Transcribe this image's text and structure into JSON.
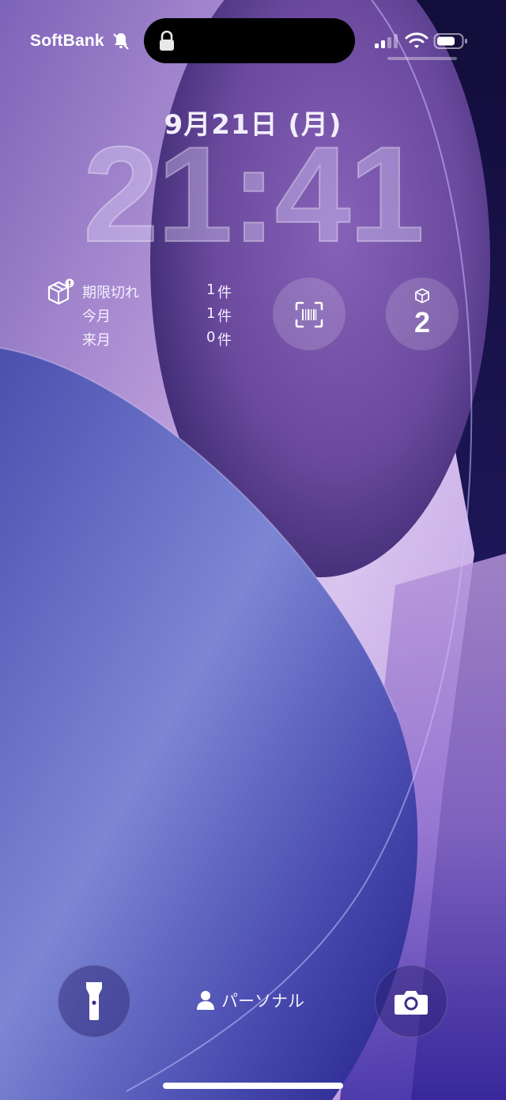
{
  "status_bar": {
    "carrier": "SoftBank",
    "icons": [
      "bell-slash-icon",
      "lock-icon",
      "cellular-signal-icon",
      "wifi-icon",
      "battery-icon"
    ]
  },
  "lock_screen": {
    "date": "9月21日 (月)",
    "time": "21:41"
  },
  "widgets": {
    "expiry_list": {
      "icon": "package-icon",
      "rows": [
        {
          "label": "期限切れ",
          "count": "1",
          "unit": "件"
        },
        {
          "label": "今月",
          "count": "1",
          "unit": "件"
        },
        {
          "label": "来月",
          "count": "0",
          "unit": "件"
        }
      ]
    },
    "barcode_scan": {
      "icon": "barcode-scan-icon"
    },
    "package_count": {
      "icon": "box-icon",
      "value": "2"
    }
  },
  "bottom": {
    "flashlight_icon": "flashlight-icon",
    "camera_icon": "camera-icon",
    "focus_icon": "person-icon",
    "focus_label": "パーソナル"
  },
  "colors": {
    "wallpaper_dark": "#1a1450",
    "wallpaper_lilac": "#c9b3ea",
    "wallpaper_purple": "#6e4fa3",
    "wallpaper_blue": "#5a5fbc"
  }
}
